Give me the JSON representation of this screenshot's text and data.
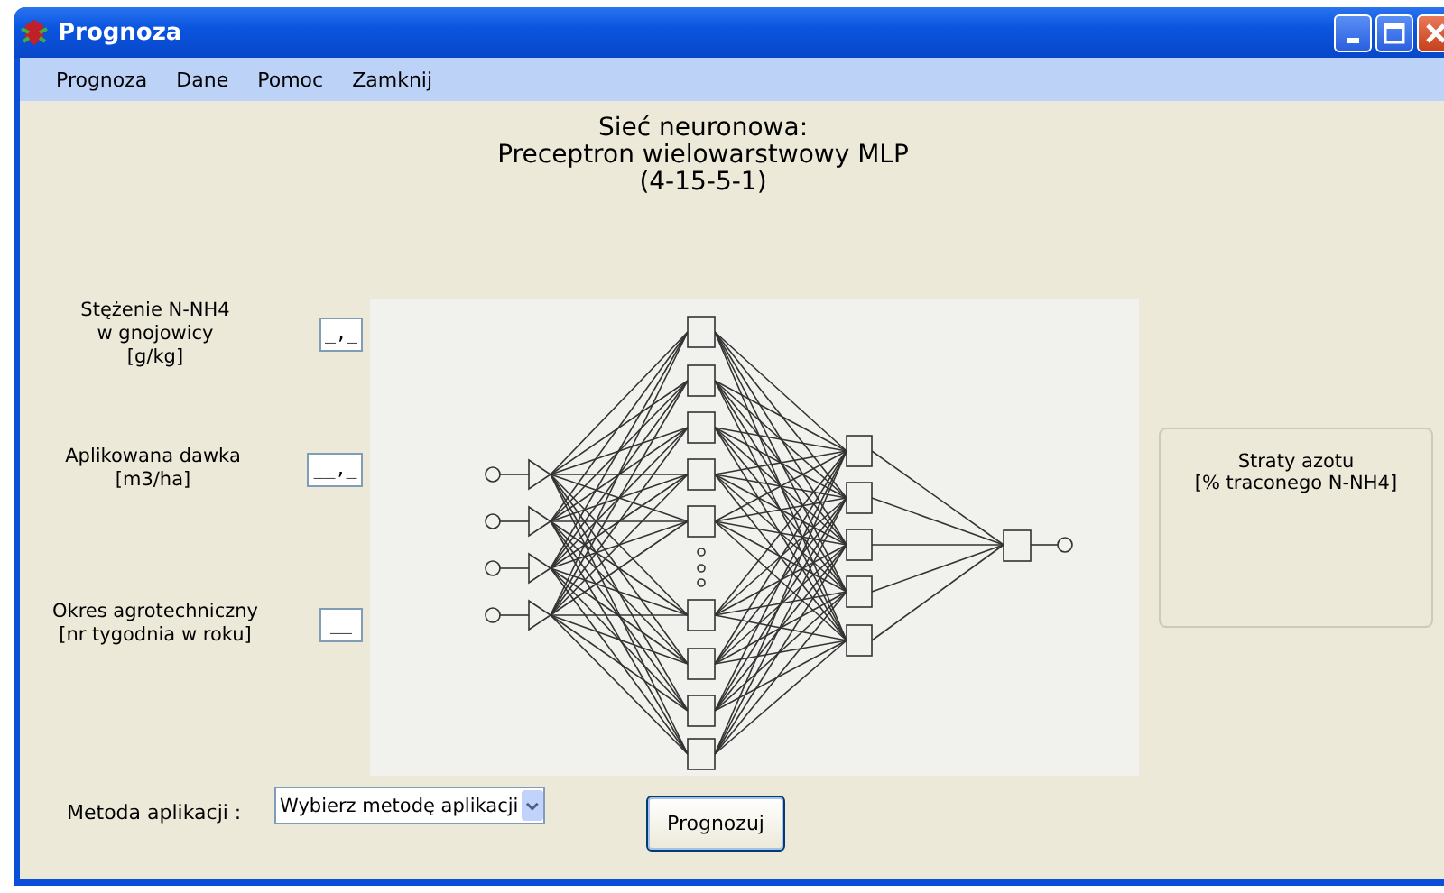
{
  "window": {
    "title": "Prognoza"
  },
  "menu": [
    "Prognoza",
    "Dane",
    "Pomoc",
    "Zamknij"
  ],
  "heading": [
    "Sieć neuronowa:",
    "Preceptron wielowarstwowy MLP",
    "(4-15-5-1)"
  ],
  "inputs": [
    {
      "label": [
        "Stężenie N-NH4",
        "w gnojowicy",
        "[g/kg]"
      ],
      "value": "_,_"
    },
    {
      "label": [
        "Aplikowana dawka",
        "[m3/ha]"
      ],
      "value": "__,_"
    },
    {
      "label": [
        "Okres agrotechniczny",
        "[nr tygodnia w roku]"
      ],
      "value": "__"
    }
  ],
  "output": {
    "label": [
      "Straty azotu",
      "[% traconego N-NH4]"
    ]
  },
  "method": {
    "label": "Metoda aplikacji :",
    "value": "Wybierz metodę aplikacji"
  },
  "button": "Prognozuj"
}
